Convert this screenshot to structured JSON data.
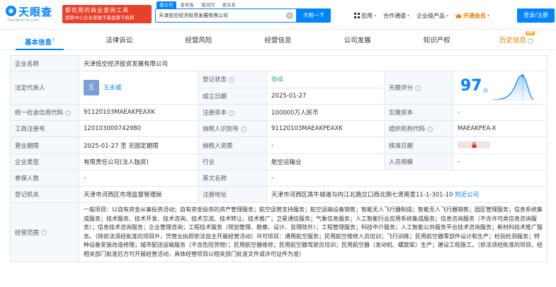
{
  "header": {
    "logo_text": "天眼查",
    "logo_sub": "TianYanCha.com",
    "promo_line1": "都在用的商业查询工具",
    "promo_line2": "国家中小企业发展子基金旗下机构",
    "search_tabs": [
      "查公司",
      "查老板",
      "查风险",
      "查关系"
    ],
    "search_value": "天津低空经济投资发展有限公司",
    "search_button": "天眼一下",
    "nav": {
      "app": "应用",
      "cooperation": "合作通道",
      "enterprise": "企业级产品",
      "vip": "开通会员"
    },
    "login_button": "登录/注册"
  },
  "tabs": [
    {
      "label": "基本信息",
      "count": "7",
      "active": true
    },
    {
      "label": "法律诉讼"
    },
    {
      "label": "经营风险"
    },
    {
      "label": "经营信息"
    },
    {
      "label": "公司发展"
    },
    {
      "label": "知识产权"
    },
    {
      "label": "历史信息",
      "vip_tag": "VIP"
    }
  ],
  "info": {
    "company_name_label": "企业名称",
    "company_name": "天津低空经济投资发展有限公司",
    "legal_rep_label": "法定代表人",
    "legal_rep_avatar": "王",
    "legal_rep": "王永威",
    "reg_status_label": "登记状态",
    "reg_status": "存续",
    "est_date_label": "成立日期",
    "est_date": "2025-01-27",
    "score_label": "天眼评分",
    "score": "97",
    "score_unit": "分",
    "credit_code_label": "统一社会信用代码",
    "credit_code": "91120103MAEAKPEAXK",
    "reg_capital_label": "注册资本",
    "reg_capital": "100000万人民币",
    "paid_capital_label": "实缴资本",
    "paid_capital": "-",
    "biz_reg_no_label": "工商注册号",
    "biz_reg_no": "120103000742980",
    "taxpayer_id_label": "纳税人识别号",
    "taxpayer_id": "91120103MAEAKPEAXK",
    "org_code_label": "组织机构代码",
    "org_code": "MAEAKPEA-X",
    "term_label": "营业期限",
    "term": "2025-01-27 至 无固定期限",
    "taxpayer_qual_label": "纳税人资质",
    "taxpayer_qual": "-",
    "approval_date_label": "核准日期",
    "company_type_label": "企业类型",
    "company_type": "有限责任公司(法人独资)",
    "industry_label": "行业",
    "industry": "航空运输业",
    "staff_size_label": "人员规模",
    "staff_size": "-",
    "insured_label": "参保人数",
    "insured": "-",
    "english_name_label": "英文名称",
    "english_name": "-",
    "reg_authority_label": "登记机关",
    "reg_authority": "天津市河西区市场监督管理局",
    "reg_address_label": "注册地址",
    "reg_address": "天津市河西区黑牛城道与内江北路交口西北侧七贤南里11-1-301-10",
    "nearby_link": "附近公司",
    "scope_label": "经营范围",
    "scope": "一般项目：以自有资金从事投资活动；自有资金投资的资产管理服务；航空运营支持服务；航空运输设备销售；智能无人飞行器制造；智能无人飞行器销售；园区管理服务；信息系统集成服务；技术服务、技术开发、技术咨询、技术交流、技术转让、技术推广；卫星通信服务；气象信息服务；人工智能行业应用系统集成服务；信息咨询服务（不含许可类信息咨询服务）；信息技术咨询服务；企业管理咨询；工程技术服务（规划管理、勘察、设计、监理除外）；工程管理服务；科技中介服务；人工智能公共服务平台技术咨询服务；新材料技术推广服务。（除依法须经批准的项目外，凭营业执照依法自主开展经营活动）许可项目：通用航空服务；民用航空维修人员培训；飞行训练；民用航空器零部件设计和生产；检验检测服务；特种设备安装改造修理；城市配送运输服务（不含危险货物）；民用航空器维修；民用航空器驾驶员培训；民用航空器（发动机、螺旋桨）生产；建设工程施工。（依法须经批准的项目，经相关部门批准后方可开展经营活动，具体经营项目以相关部门批准文件或许可证件为准）"
  }
}
